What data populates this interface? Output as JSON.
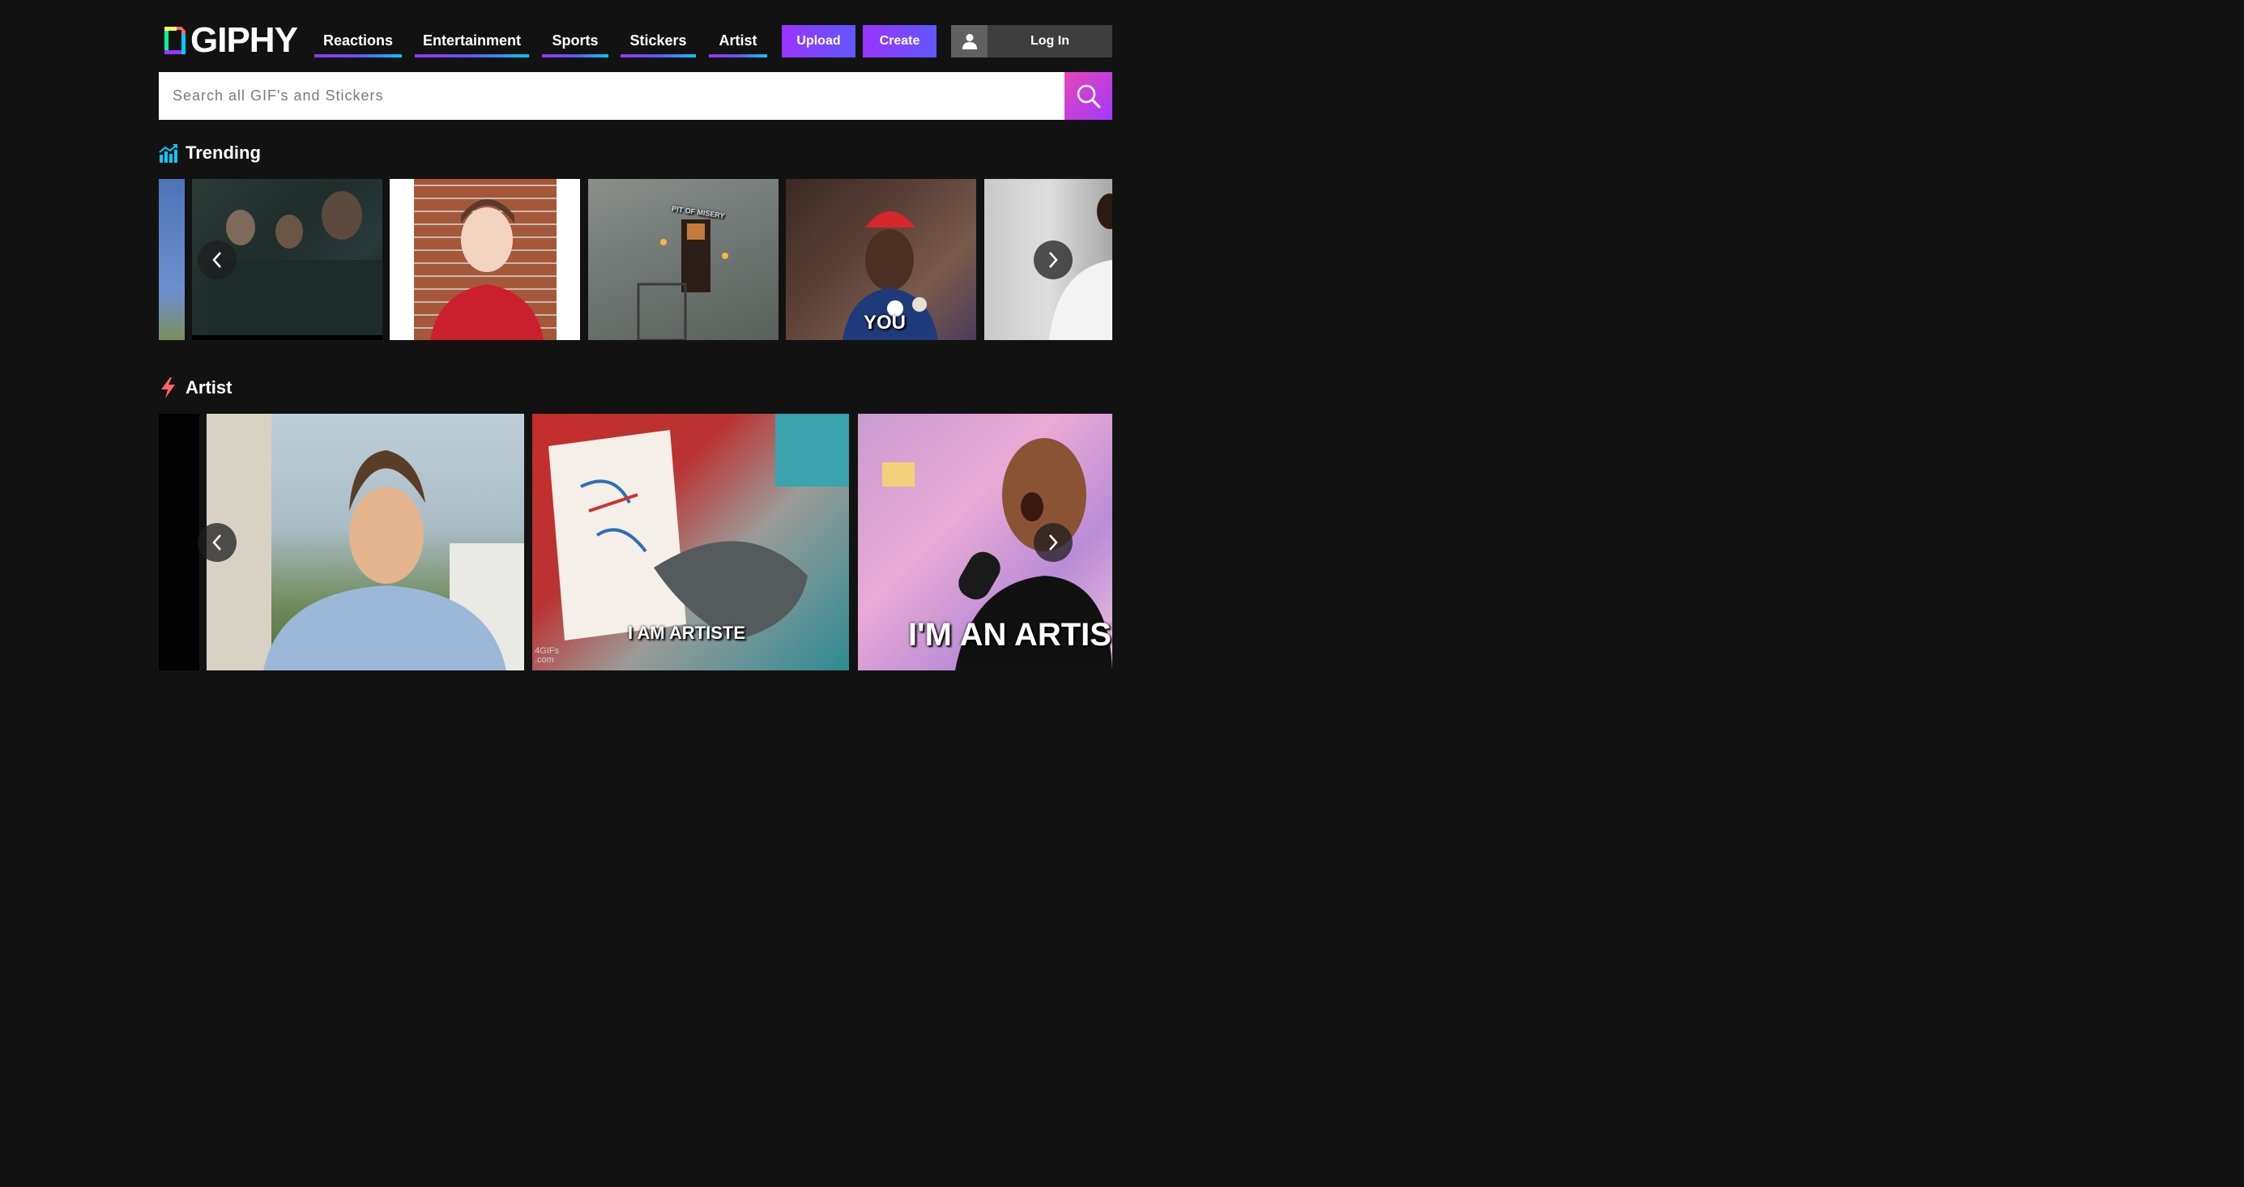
{
  "brand": {
    "name": "GIPHY"
  },
  "nav": [
    {
      "label": "Reactions"
    },
    {
      "label": "Entertainment"
    },
    {
      "label": "Sports"
    },
    {
      "label": "Stickers"
    },
    {
      "label": "Artist"
    }
  ],
  "actions": {
    "upload": "Upload",
    "create": "Create",
    "login": "Log In"
  },
  "search": {
    "placeholder": "Search all GIF's and Stickers"
  },
  "trending": {
    "title": "Trending",
    "tiles": [
      {
        "caption": ""
      },
      {
        "caption": ""
      },
      {
        "caption": ""
      },
      {
        "caption": "PIT OF MISERY"
      },
      {
        "caption": "YOU"
      },
      {
        "caption": ""
      }
    ]
  },
  "artist": {
    "title": "Artist",
    "tiles": [
      {
        "caption": ""
      },
      {
        "caption": ""
      },
      {
        "caption": "I AM ARTISTE",
        "watermark": "4GIFs .com"
      },
      {
        "caption": "I'M AN ARTIST"
      }
    ]
  },
  "colors": {
    "background": "#121212",
    "nav_bars": [
      "#00ccff",
      "#9933ff",
      "#00ff99",
      "#fff35c",
      "#ff6666"
    ],
    "accent": "#9933ff"
  }
}
